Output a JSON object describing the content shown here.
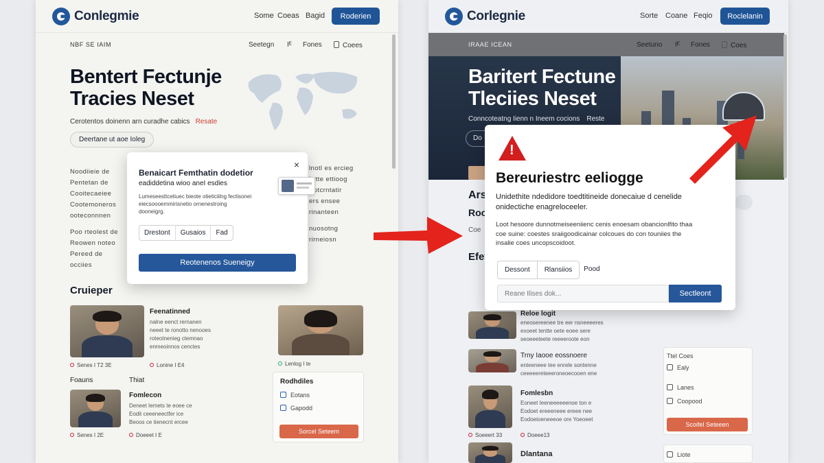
{
  "brand": {
    "name": "Conlegmie",
    "name_right": "Corlegnie"
  },
  "left": {
    "nav": [
      "Some",
      "Coeas",
      "Bagid"
    ],
    "cta": "Roderien",
    "subnav": {
      "left": "NBF SE IAIM",
      "items": [
        "Seetegn",
        "Fones",
        "Coees"
      ]
    },
    "hero": {
      "title_line1": "Bentert Fectunje",
      "title_line2": "Tracies Neset",
      "subtitle": "Cerotentos doinenn arn curadhe cabics",
      "subtitle_link": "Resate",
      "pill": "Deertane ut aoe Ioleg"
    },
    "sketch_text": [
      "Noodiieie de",
      "Pentetan de",
      "Cooitecaeiee",
      "Cootemoneros",
      "ooteconnnen",
      "Poo rteolest de",
      "Reowen noteo",
      "Pereed de",
      "occiies"
    ],
    "right_sketch": [
      "lnotl es ercieg",
      "irrtte ettioog",
      "Eotcrntatir",
      "ers ensee",
      "rinanteen",
      "nuosotng",
      "rirneiosn"
    ],
    "modal": {
      "title": "Benaicart Femthatin dodetior",
      "subtitle": "eadiddetina wioo aneI esdies",
      "body": "Lumeseesttcetiuec bieote otieticiilng fectisonei eiecsoooemmirisnetio ornenestroing\ndooneigrg.",
      "options": [
        "Drestont",
        "Gusaios",
        "Fad"
      ],
      "button": "Reotenenos Sueneigy",
      "close": "×"
    },
    "section": "Cruieper",
    "card1": {
      "title": "Feenatinned",
      "text": "nalne eenct rernanen\nneeet te ronotto nenooes\nroteotnenieg ctemnao\nenmeoinnos cenctes",
      "meta": "Senes I T2 3E",
      "meta2": "Lonine I E4"
    },
    "card2_meta": "Lenlog I te",
    "tabs": [
      "Foauns",
      "Thiat"
    ],
    "card3": {
      "title": "Fomlecon",
      "text": "Deneet Iemets te eoee ce\nEodit ceeeneectfer ice\nBeoos ce tienecnt ercee",
      "meta": "Senes I 2E",
      "meta2": "Doeeet I E"
    },
    "sidebox": {
      "title": "Rodhdiles",
      "items": [
        "Eotans",
        "Gapodd"
      ],
      "button": "Sorcel Seteem"
    }
  },
  "right": {
    "nav": [
      "Sorte",
      "Coane",
      "Feqio"
    ],
    "cta": "Roclelanin",
    "subnav": {
      "left": "IRAAE ICEAN",
      "items": [
        "Seetuno",
        "Fones",
        "Coes"
      ]
    },
    "hero": {
      "title_line1": "Baritert Fectune",
      "title_line2": "Tleciies Neset",
      "subtitle": "Conncoteatng Iienn n Ineem cocions",
      "subtitle_link": "Reste",
      "pill_fragment": "Do"
    },
    "left_fragments": [
      "Ars",
      "Roo",
      "Coe",
      "Efet"
    ],
    "modal": {
      "title": "Bereuriestrc eeliogge",
      "lead": "Unidethite ndedidore toedtitineide donecaiue d cenelide\nonidectiche enagreloceeler.",
      "body": "Loot hesoore dunnotmeiseeniienc cenis enoesam obancionlfito thaa\ncoe suine: coestes sraiigoodicainar colcoues do con touniies the\ninsalie coes uncopscoidoot.",
      "options": [
        "Dessont",
        "Rlansiios",
        "Pood"
      ],
      "input_placeholder": "Reane Ilises dok...",
      "button": "Sectleont"
    },
    "list": [
      {
        "title": "Reloe logit",
        "text": "eneosereenee tre eer nsneeeeres\nexoeet tentte oete eoee sere\nseoeeeteete reeeeroote eon"
      },
      {
        "title": "Trny Iaooe eossnoere",
        "text": "enteeneee tee enrele sontenne\nceeeeereteeeroneoecooen ene"
      },
      {
        "title": "Fomlesbn",
        "text": "Eoneet Ieeneeeeeenoe ton e\nEodoet ereeeneee ereee nee\nEodoeioeneeeoe ore Yoeoeet"
      },
      {
        "title": "Dlantana",
        "text": ""
      }
    ],
    "list_meta": [
      "Soeeert 33",
      "Doeee13"
    ],
    "sidebox": {
      "title": "Ttel Coes",
      "items": [
        "Ealy",
        "Lanes",
        "Coopood"
      ],
      "button": "Scoifel Seteeen",
      "extra": "Liote"
    }
  }
}
